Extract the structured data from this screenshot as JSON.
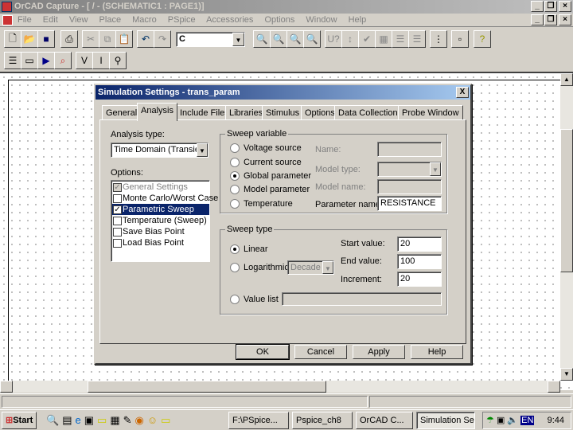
{
  "app": {
    "title": "OrCAD Capture - [ / - (SCHEMATIC1 : PAGE1)]"
  },
  "menu": [
    "File",
    "Edit",
    "View",
    "Place",
    "Macro",
    "PSpice",
    "Accessories",
    "Options",
    "Window",
    "Help"
  ],
  "toolbar": {
    "part_combo_value": "C"
  },
  "dialog": {
    "title": "Simulation Settings - trans_param",
    "close": "X",
    "tabs": [
      "General",
      "Analysis",
      "Include Files",
      "Libraries",
      "Stimulus",
      "Options",
      "Data Collection",
      "Probe Window"
    ],
    "active_tab": "Analysis",
    "analysis_type_label": "Analysis type:",
    "analysis_type_value": "Time Domain (Transient)",
    "options_label": "Options:",
    "options": [
      {
        "label": "General Settings",
        "checked": true,
        "disabled": true
      },
      {
        "label": "Monte Carlo/Worst Case",
        "checked": false
      },
      {
        "label": "Parametric Sweep",
        "checked": true,
        "selected": true
      },
      {
        "label": "Temperature (Sweep)",
        "checked": false
      },
      {
        "label": "Save Bias Point",
        "checked": false
      },
      {
        "label": "Load Bias Point",
        "checked": false
      }
    ],
    "sweep_variable": {
      "legend": "Sweep variable",
      "radios": [
        "Voltage source",
        "Current source",
        "Global parameter",
        "Model parameter",
        "Temperature"
      ],
      "selected": "Global parameter",
      "name_label": "Name:",
      "name_value": "",
      "model_type_label": "Model type:",
      "model_type_value": "",
      "model_name_label": "Model name:",
      "model_name_value": "",
      "param_name_label": "Parameter name:",
      "param_name_value": "RESISTANCE"
    },
    "sweep_type": {
      "legend": "Sweep type",
      "linear": "Linear",
      "log": "Logarithmic",
      "log_value": "Decade",
      "value_list": "Value list",
      "value_list_value": "",
      "selected": "Linear",
      "start_label": "Start value:",
      "start_value": "20",
      "end_label": "End value:",
      "end_value": "100",
      "inc_label": "Increment:",
      "inc_value": "20"
    },
    "buttons": {
      "ok": "OK",
      "cancel": "Cancel",
      "apply": "Apply",
      "help": "Help"
    }
  },
  "taskbar": {
    "start": "Start",
    "tasks": [
      "F:\\PSpice...",
      "Pspice_ch8",
      "OrCAD C...",
      "Simulation Se..."
    ],
    "lang": "EN",
    "clock": "9:44"
  }
}
